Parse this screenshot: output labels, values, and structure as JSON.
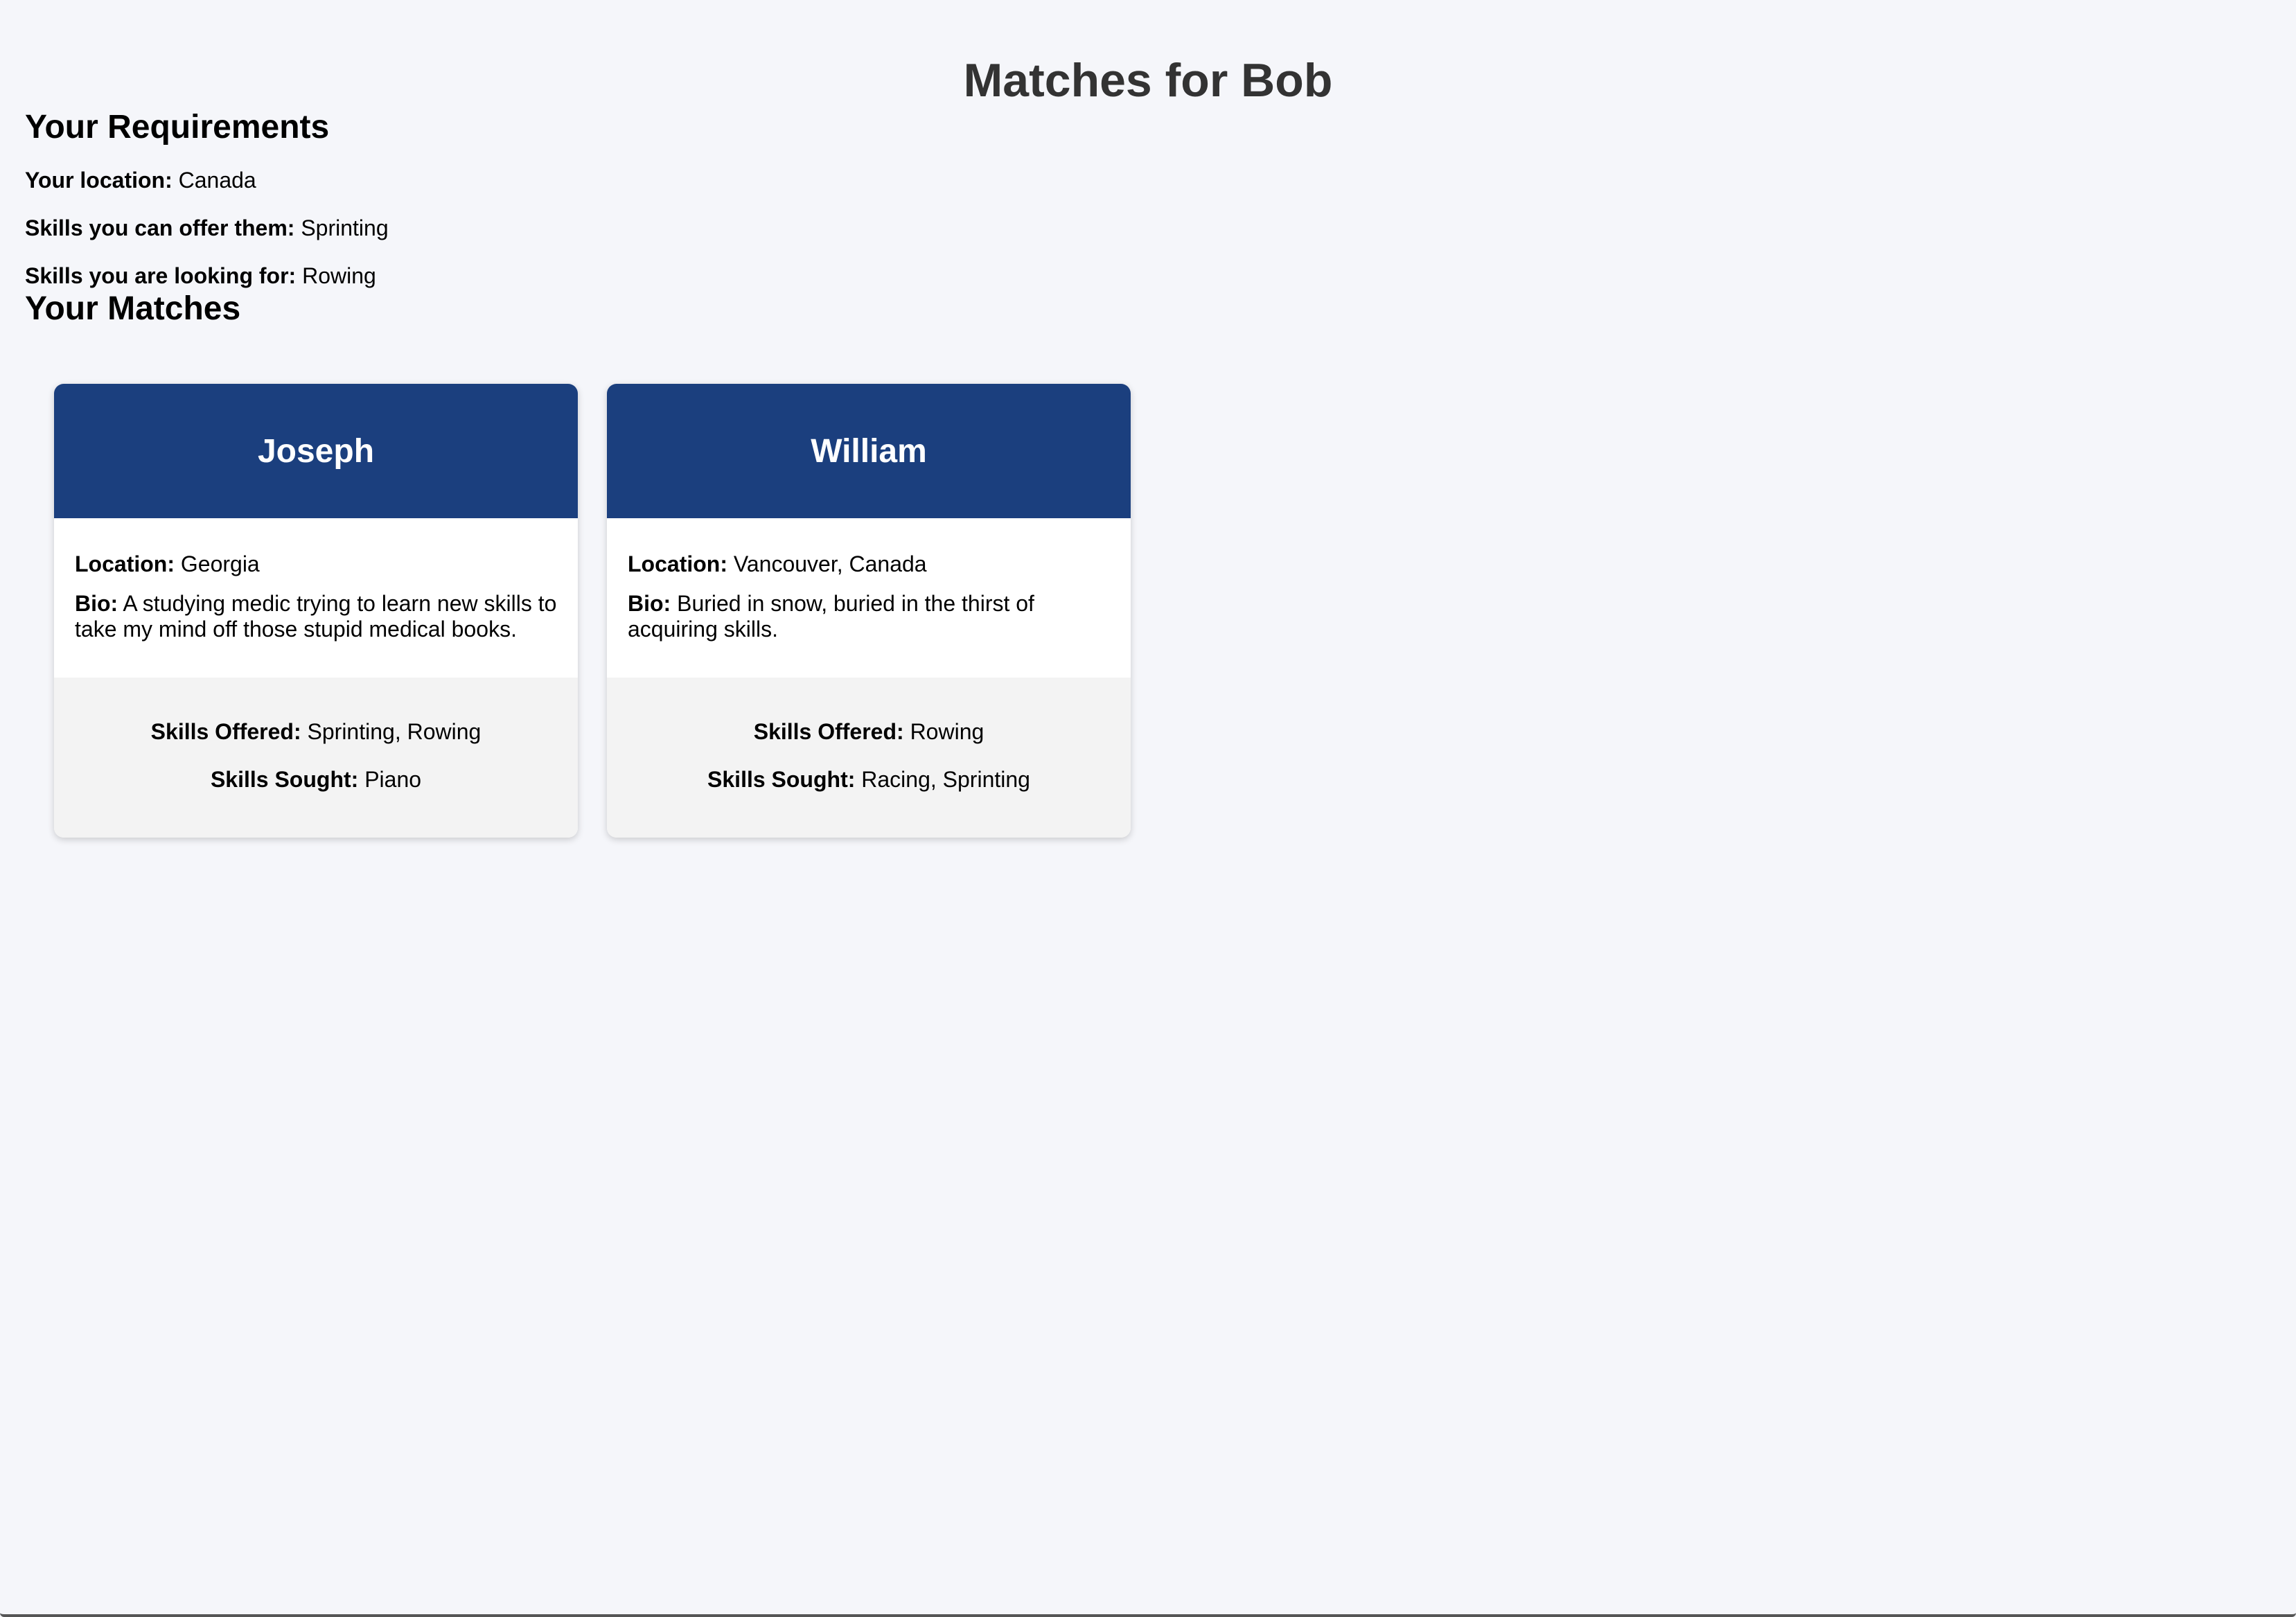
{
  "page": {
    "title": "Matches for Bob"
  },
  "requirements": {
    "heading": "Your Requirements",
    "location_label": "Your location:",
    "location_value": "Canada",
    "offer_label": "Skills you can offer them:",
    "offer_value": "Sprinting",
    "seeking_label": "Skills you are looking for:",
    "seeking_value": "Rowing"
  },
  "matches": {
    "heading": "Your Matches",
    "location_label": "Location:",
    "bio_label": "Bio:",
    "offered_label": "Skills Offered:",
    "sought_label": "Skills Sought:",
    "cards": [
      {
        "name": "Joseph",
        "location": "Georgia",
        "bio": "A studying medic trying to learn new skills to take my mind off those stupid medical books.",
        "skills_offered": "Sprinting, Rowing",
        "skills_sought": "Piano"
      },
      {
        "name": "William",
        "location": "Vancouver, Canada",
        "bio": "Buried in snow, buried in the thirst of acquiring skills.",
        "skills_offered": "Rowing",
        "skills_sought": "Racing, Sprinting"
      }
    ]
  },
  "colors": {
    "background": "#f5f6fa",
    "card_header": "#1b3f7e",
    "card_footer": "#f3f3f3",
    "title_text": "#333333"
  }
}
